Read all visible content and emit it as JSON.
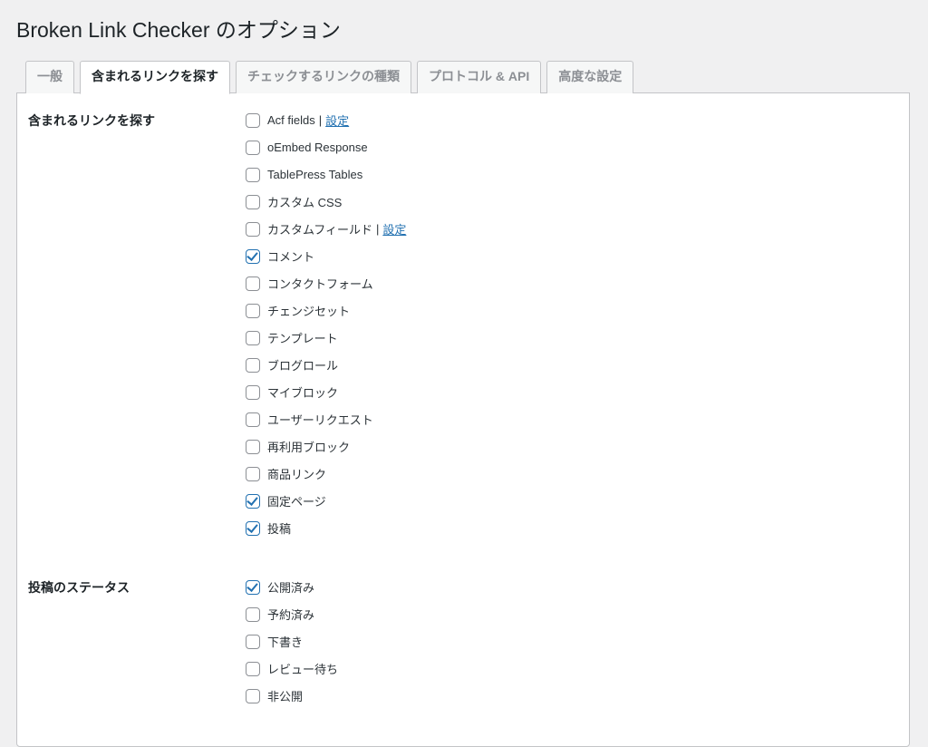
{
  "page_title": "Broken Link Checker のオプション",
  "tabs": [
    {
      "id": "general",
      "label": "一般"
    },
    {
      "id": "where",
      "label": "含まれるリンクを探す"
    },
    {
      "id": "which",
      "label": "チェックするリンクの種類"
    },
    {
      "id": "protocols",
      "label": "プロトコル & API"
    },
    {
      "id": "advanced",
      "label": "高度な設定"
    }
  ],
  "active_tab": "where",
  "section_link_sources": {
    "heading": "含まれるリンクを探す",
    "settings_link_label": "設定",
    "items": [
      {
        "id": "acf",
        "label": "Acf fields",
        "checked": false,
        "has_settings": true
      },
      {
        "id": "oembed",
        "label": "oEmbed Response",
        "checked": false
      },
      {
        "id": "tablepress",
        "label": "TablePress Tables",
        "checked": false
      },
      {
        "id": "custom-css",
        "label": "カスタム CSS",
        "checked": false
      },
      {
        "id": "custom-field",
        "label": "カスタムフィールド",
        "checked": false,
        "has_settings": true
      },
      {
        "id": "comment",
        "label": "コメント",
        "checked": true
      },
      {
        "id": "contact-form",
        "label": "コンタクトフォーム",
        "checked": false
      },
      {
        "id": "changeset",
        "label": "チェンジセット",
        "checked": false
      },
      {
        "id": "template",
        "label": "テンプレート",
        "checked": false
      },
      {
        "id": "blogroll",
        "label": "ブログロール",
        "checked": false
      },
      {
        "id": "my-block",
        "label": "マイブロック",
        "checked": false
      },
      {
        "id": "user-request",
        "label": "ユーザーリクエスト",
        "checked": false
      },
      {
        "id": "reusable",
        "label": "再利用ブロック",
        "checked": false
      },
      {
        "id": "product-link",
        "label": "商品リンク",
        "checked": false
      },
      {
        "id": "page",
        "label": "固定ページ",
        "checked": true
      },
      {
        "id": "post",
        "label": "投稿",
        "checked": true
      }
    ]
  },
  "section_post_status": {
    "heading": "投稿のステータス",
    "items": [
      {
        "id": "publish",
        "label": "公開済み",
        "checked": true
      },
      {
        "id": "future",
        "label": "予約済み",
        "checked": false
      },
      {
        "id": "draft",
        "label": "下書き",
        "checked": false
      },
      {
        "id": "pending",
        "label": "レビュー待ち",
        "checked": false
      },
      {
        "id": "private",
        "label": "非公開",
        "checked": false
      }
    ]
  }
}
